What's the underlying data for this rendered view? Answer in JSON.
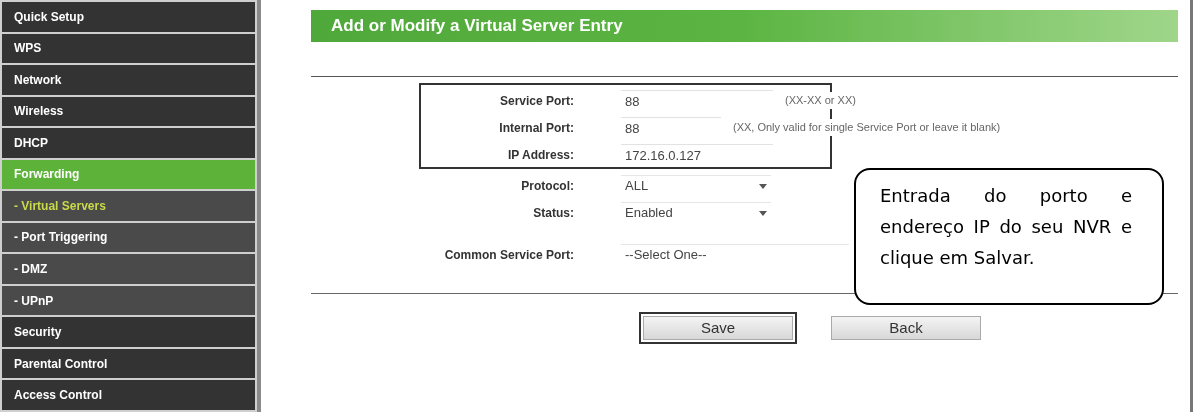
{
  "sidebar": {
    "items": [
      {
        "label": "Quick Setup",
        "kind": "section",
        "selected": false
      },
      {
        "label": "WPS",
        "kind": "section",
        "selected": false
      },
      {
        "label": "Network",
        "kind": "section",
        "selected": false
      },
      {
        "label": "Wireless",
        "kind": "section",
        "selected": false
      },
      {
        "label": "DHCP",
        "kind": "section",
        "selected": false
      },
      {
        "label": "Forwarding",
        "kind": "section",
        "selected": true
      },
      {
        "label": "- Virtual Servers",
        "kind": "subitem",
        "selected": true
      },
      {
        "label": "- Port Triggering",
        "kind": "subitem",
        "selected": false
      },
      {
        "label": "- DMZ",
        "kind": "subitem",
        "selected": false
      },
      {
        "label": "- UPnP",
        "kind": "subitem",
        "selected": false
      },
      {
        "label": "Security",
        "kind": "section",
        "selected": false
      },
      {
        "label": "Parental Control",
        "kind": "section",
        "selected": false
      },
      {
        "label": "Access Control",
        "kind": "section",
        "selected": false
      }
    ]
  },
  "panel": {
    "title": "Add or Modify a Virtual Server Entry",
    "fields": [
      {
        "label": "Service Port:",
        "kind": "wide-text",
        "value": "88",
        "hint": "(XX-XX or XX)",
        "highlighted": true
      },
      {
        "label": "Internal Port:",
        "kind": "narrow-text",
        "value": "88",
        "hint": "(XX, Only valid for single Service Port or leave it blank)",
        "highlighted": true
      },
      {
        "label": "IP Address:",
        "kind": "wide-text",
        "value": "172.16.0.127",
        "highlighted": true
      },
      {
        "label": "Protocol:",
        "kind": "select",
        "value": "ALL",
        "highlighted": false
      },
      {
        "label": "Status:",
        "kind": "select",
        "value": "Enabled",
        "highlighted": false
      },
      {
        "label": "Common Service Port:",
        "kind": "wide-select",
        "value": "--Select One--",
        "highlighted": false
      }
    ],
    "buttons": [
      {
        "label": "Save",
        "highlighted": true
      },
      {
        "label": "Back",
        "highlighted": false
      }
    ]
  },
  "callout": {
    "text": "Entrada do porto e endereço IP do seu NVR e clique em Salvar."
  }
}
